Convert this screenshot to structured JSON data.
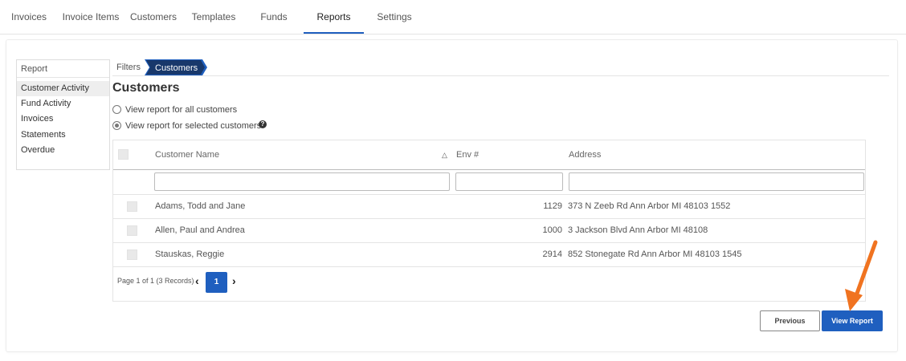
{
  "nav": {
    "tabs": [
      {
        "label": "Invoices"
      },
      {
        "label": "Invoice Items"
      },
      {
        "label": "Customers"
      },
      {
        "label": "Templates"
      },
      {
        "label": "Funds"
      },
      {
        "label": "Reports"
      },
      {
        "label": "Settings"
      }
    ],
    "active": "Reports"
  },
  "report_menu": {
    "header": "Report",
    "items": [
      {
        "label": "Customer Activity"
      },
      {
        "label": "Fund Activity"
      },
      {
        "label": "Invoices"
      },
      {
        "label": "Statements"
      },
      {
        "label": "Overdue"
      }
    ],
    "selected": "Customer Activity"
  },
  "breadcrumb": {
    "filters": "Filters",
    "current": "Customers"
  },
  "section_title": "Customers",
  "options": {
    "all": "View report for all customers",
    "selected": "View report for selected customers",
    "selected_checked": true
  },
  "table": {
    "columns": {
      "name": "Customer Name",
      "env": "Env #",
      "address": "Address"
    },
    "rows": [
      {
        "name": "Adams, Todd and Jane",
        "env": "1129",
        "address": "373 N Zeeb Rd Ann Arbor MI 48103 1552"
      },
      {
        "name": "Allen, Paul and Andrea",
        "env": "1000",
        "address": "3 Jackson Blvd Ann Arbor MI 48108"
      },
      {
        "name": "Stauskas, Reggie",
        "env": "2914",
        "address": "852 Stonegate Rd Ann Arbor MI 48103 1545"
      }
    ],
    "pager": {
      "summary": "Page 1 of 1 (3 Records)",
      "current_page": "1"
    }
  },
  "buttons": {
    "previous": "Previous",
    "view_report": "View Report"
  },
  "colors": {
    "accent": "#1f5fbf",
    "breadcrumb_active": "#1f5fbf",
    "annotation_arrow": "#f07320"
  }
}
